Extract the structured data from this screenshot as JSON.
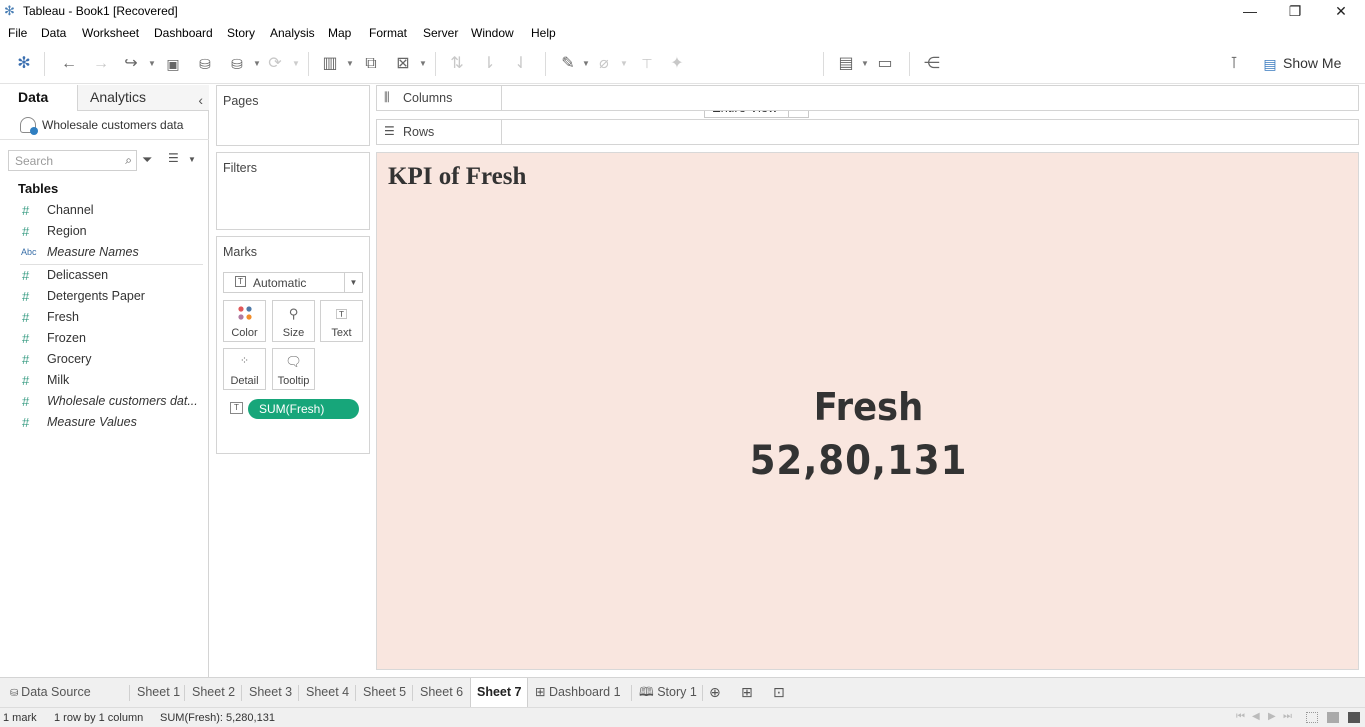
{
  "window": {
    "title": "Tableau - Book1 [Recovered]"
  },
  "menu": [
    "File",
    "Data",
    "Worksheet",
    "Dashboard",
    "Story",
    "Analysis",
    "Map",
    "Format",
    "Server",
    "Window",
    "Help"
  ],
  "toolbar": {
    "fit_value": "Entire View",
    "show_me_label": "Show Me"
  },
  "data_pane": {
    "tabs": {
      "data": "Data",
      "analytics": "Analytics"
    },
    "datasource": "Wholesale customers data",
    "search_placeholder": "Search",
    "tables_header": "Tables",
    "fields": [
      {
        "type": "#",
        "name": "Channel",
        "italic": false
      },
      {
        "type": "#",
        "name": "Region",
        "italic": false
      },
      {
        "type": "Abc",
        "name": "Measure Names",
        "italic": true
      },
      {
        "type": "#",
        "name": "Delicassen",
        "italic": false
      },
      {
        "type": "#",
        "name": "Detergents Paper",
        "italic": false
      },
      {
        "type": "#",
        "name": "Fresh",
        "italic": false
      },
      {
        "type": "#",
        "name": "Frozen",
        "italic": false
      },
      {
        "type": "#",
        "name": "Grocery",
        "italic": false
      },
      {
        "type": "#",
        "name": "Milk",
        "italic": false
      },
      {
        "type": "#",
        "name": "Wholesale customers dat...",
        "italic": true
      },
      {
        "type": "#",
        "name": "Measure Values",
        "italic": true
      }
    ]
  },
  "cards": {
    "pages": "Pages",
    "filters": "Filters",
    "marks": {
      "title": "Marks",
      "type": "Automatic",
      "buttons": {
        "color": "Color",
        "size": "Size",
        "text": "Text",
        "detail": "Detail",
        "tooltip": "Tooltip"
      },
      "pill": "SUM(Fresh)",
      "pill_color": "#17a67a"
    }
  },
  "shelves": {
    "columns": "Columns",
    "rows": "Rows"
  },
  "viz": {
    "title": "KPI of Fresh",
    "kpi_label": "Fresh",
    "kpi_value": "52,80,131",
    "background": "#f9e6df"
  },
  "sheet_tabs": {
    "data_source": "Data Source",
    "tabs": [
      "Sheet 1",
      "Sheet 2",
      "Sheet 3",
      "Sheet 4",
      "Sheet 5",
      "Sheet 6",
      "Sheet 7",
      "Dashboard 1",
      "Story 1"
    ],
    "active": "Sheet 7"
  },
  "status": {
    "marks": "1 mark",
    "dims": "1 row by 1 column",
    "sum": "SUM(Fresh): 5,280,131"
  }
}
